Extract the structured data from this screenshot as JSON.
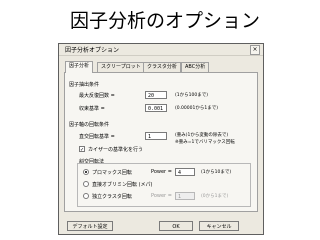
{
  "slide_title": "因子分析のオプション",
  "dialog": {
    "title": "因子分析オプション",
    "close_glyph": "×",
    "tabs": [
      "因子分析",
      "スクリープロット",
      "クラスタ分析",
      "ABC分析"
    ],
    "extraction": {
      "group_label": "因子抽出条件",
      "max_iter_label": "最大反復回数 =",
      "max_iter_value": "20",
      "max_iter_hint": "(1から100まで)",
      "conv_label": "収束基準 =",
      "conv_value": "0.001",
      "conv_hint": "(0.00001から1まで)"
    },
    "rotation": {
      "group_label": "因子軸の回転条件",
      "exponent_label": "直交回転基準 =",
      "exponent_value": "1",
      "exponent_hint_1": "(重み)1から変動の除去で)",
      "exponent_hint_2": "※重み=1でバリマックス回転",
      "kaiser_label": "カイザーの基準化を行う",
      "kaiser_checked": "✓",
      "method_group_label": "斜交回転法",
      "methods": [
        {
          "label": "プロマックス回転",
          "power_label": "Power =",
          "power_value": "4",
          "hint": "(1から10まで)",
          "selected": true
        },
        {
          "label": "直接オブリミン回転 (メパ)",
          "power_label": "",
          "power_value": "",
          "hint": "",
          "selected": false
        },
        {
          "label": "独立クラスタ回転",
          "power_label": "Power =",
          "power_value": "1",
          "hint": "(0から1まで)",
          "selected": false
        }
      ]
    },
    "buttons": {
      "default": "デフォルト設定",
      "ok": "OK",
      "cancel": "キャンセル"
    }
  }
}
